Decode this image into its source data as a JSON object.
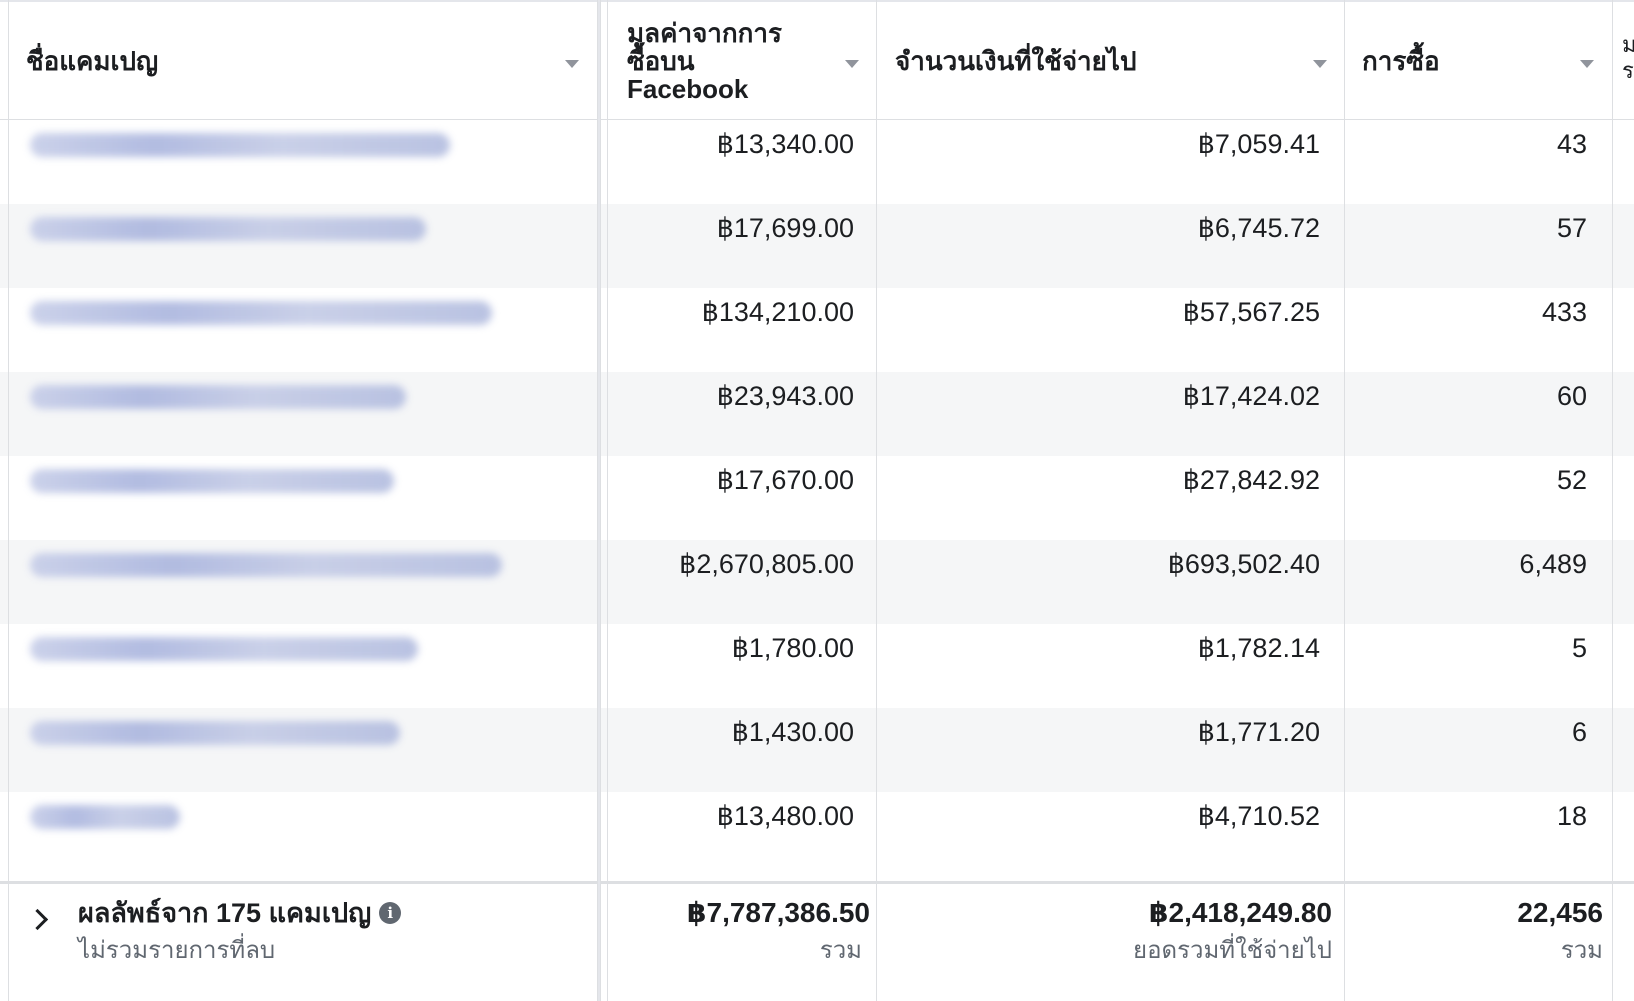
{
  "header": {
    "campaign_name": "ชื่อแคมเปญ",
    "purchase_value": [
      "มูลค่าจากการ",
      "ซื้อบน",
      "Facebook"
    ],
    "amount_spent": "จำนวนเงินที่ใช้จ่ายไป",
    "purchases": "การซื้อ",
    "next_col_glyphs": [
      "ม",
      "ร"
    ]
  },
  "rows": [
    {
      "value": "฿13,340.00",
      "spent": "฿7,059.41",
      "purchases": "43"
    },
    {
      "value": "฿17,699.00",
      "spent": "฿6,745.72",
      "purchases": "57"
    },
    {
      "value": "฿134,210.00",
      "spent": "฿57,567.25",
      "purchases": "433"
    },
    {
      "value": "฿23,943.00",
      "spent": "฿17,424.02",
      "purchases": "60"
    },
    {
      "value": "฿17,670.00",
      "spent": "฿27,842.92",
      "purchases": "52"
    },
    {
      "value": "฿2,670,805.00",
      "spent": "฿693,502.40",
      "purchases": "6,489"
    },
    {
      "value": "฿1,780.00",
      "spent": "฿1,782.14",
      "purchases": "5"
    },
    {
      "value": "฿1,430.00",
      "spent": "฿1,771.20",
      "purchases": "6"
    },
    {
      "value": "฿13,480.00",
      "spent": "฿4,710.52",
      "purchases": "18"
    }
  ],
  "footer": {
    "summary_title": "ผลลัพธ์จาก 175 แคมเปญ",
    "summary_sub": "ไม่รวมรายการที่ลบ",
    "info_glyph": "i",
    "total_value": "฿7,787,386.50",
    "total_value_sub": "รวม",
    "total_spent": "฿2,418,249.80",
    "total_spent_sub": "ยอดรวมที่ใช้จ่ายไป",
    "total_purchases": "22,456",
    "total_purchases_sub": "รวม"
  }
}
